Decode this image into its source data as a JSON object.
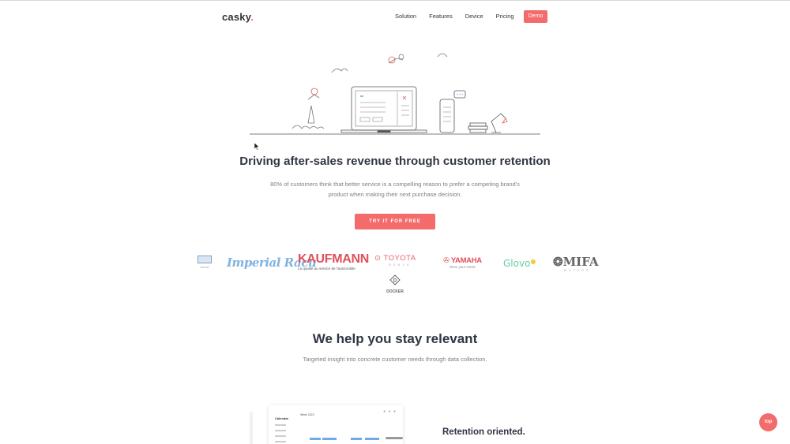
{
  "nav": {
    "logo": "casky",
    "logo_dot": ".",
    "items": [
      "Solution",
      "Features",
      "Device",
      "Pricing"
    ],
    "demo": "Demo"
  },
  "hero": {
    "headline": "Driving after-sales revenue through customer retention",
    "subtext": "80% of customers think that better service is a compelling reason to prefer a competing brand's product when making their next purchase decision.",
    "cta": "TRY IT FOR FREE"
  },
  "brands": {
    "mark_text": "brand",
    "imperial": "Imperial Racu",
    "kaufmann": "KAUFMANN",
    "kaufmann_tag": "La qualité au service de l'automobile",
    "toyota": "TOYOTA",
    "toyota_sub": "DENYA",
    "yamaha": "YAMAHA",
    "yamaha_sub": "Revs your Heart",
    "glovo": "Glovo",
    "mifa": "MIFA",
    "mifa_sub": "MOTORS",
    "docker": "DOCKER"
  },
  "section2": {
    "title": "We help you stay relevant",
    "subtitle": "Targeted insight into concrete customer needs through data collection."
  },
  "dashboard": {
    "title": "Calendar",
    "period": "Week 2022"
  },
  "feature": {
    "title": "Retention oriented."
  },
  "top_button": "top",
  "colors": {
    "accent": "#f46b6b",
    "text": "#2f3542",
    "muted": "#7a7f87"
  }
}
